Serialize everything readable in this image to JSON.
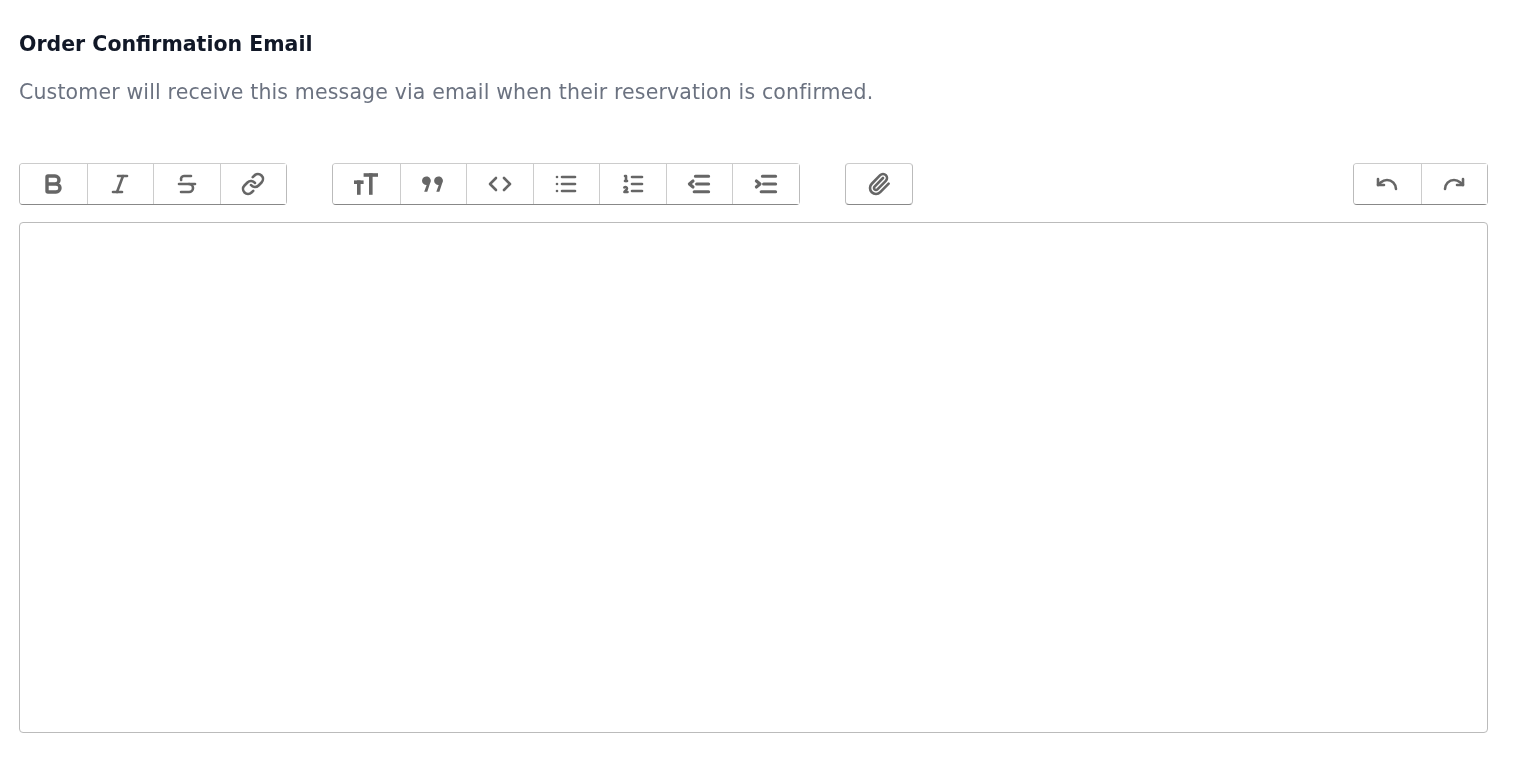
{
  "title": "Order Confirmation Email",
  "description": "Customer will receive this message via email when their reservation is confirmed.",
  "toolbar": {
    "start_groups": [
      {
        "buttons": [
          {
            "kind": "bold"
          },
          {
            "kind": "italic"
          },
          {
            "kind": "strike"
          },
          {
            "kind": "link"
          }
        ]
      },
      {
        "buttons": [
          {
            "kind": "heading"
          },
          {
            "kind": "quote"
          },
          {
            "kind": "code"
          },
          {
            "kind": "bullets"
          },
          {
            "kind": "numbers"
          },
          {
            "kind": "outdent"
          },
          {
            "kind": "indent"
          }
        ]
      },
      {
        "buttons": [
          {
            "kind": "attach"
          }
        ]
      }
    ],
    "end_groups": [
      {
        "buttons": [
          {
            "kind": "undo"
          },
          {
            "kind": "redo"
          }
        ]
      }
    ]
  }
}
